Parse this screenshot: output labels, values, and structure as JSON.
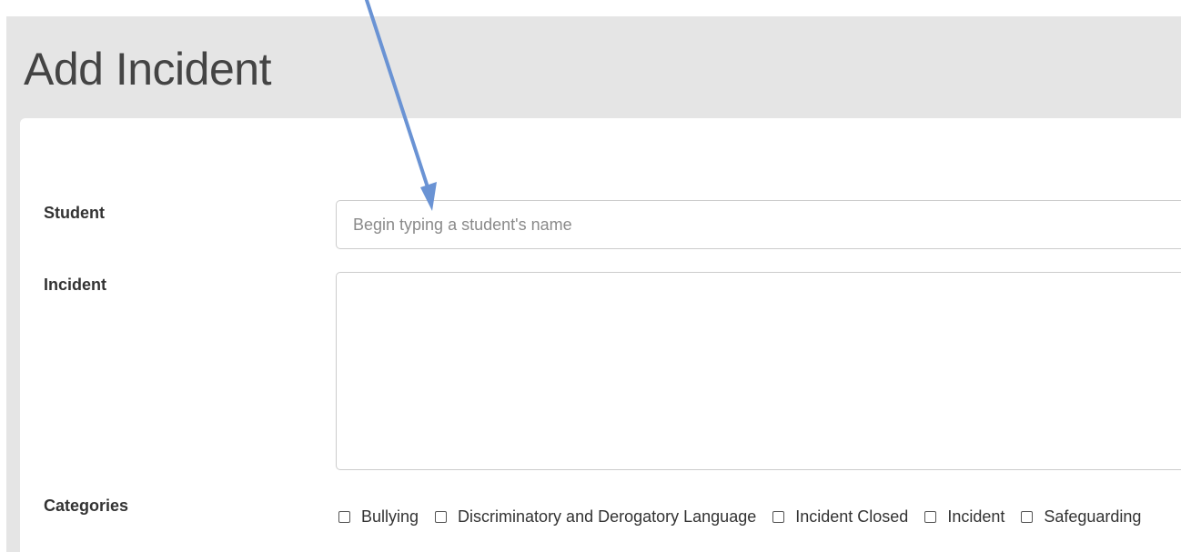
{
  "page": {
    "title": "Add Incident"
  },
  "form": {
    "student": {
      "label": "Student",
      "value": "",
      "placeholder": "Begin typing a student's name"
    },
    "incident": {
      "label": "Incident",
      "value": ""
    },
    "categories": {
      "label": "Categories",
      "options": [
        {
          "label": "Bullying",
          "checked": false
        },
        {
          "label": "Discriminatory and Derogatory Language",
          "checked": false
        },
        {
          "label": "Incident Closed",
          "checked": false
        },
        {
          "label": "Incident",
          "checked": false
        },
        {
          "label": "Safeguarding",
          "checked": false
        }
      ]
    }
  },
  "colors": {
    "header_band": "#e5e5e5",
    "title_text": "#444444",
    "annotation_arrow": "#6a93d4"
  }
}
